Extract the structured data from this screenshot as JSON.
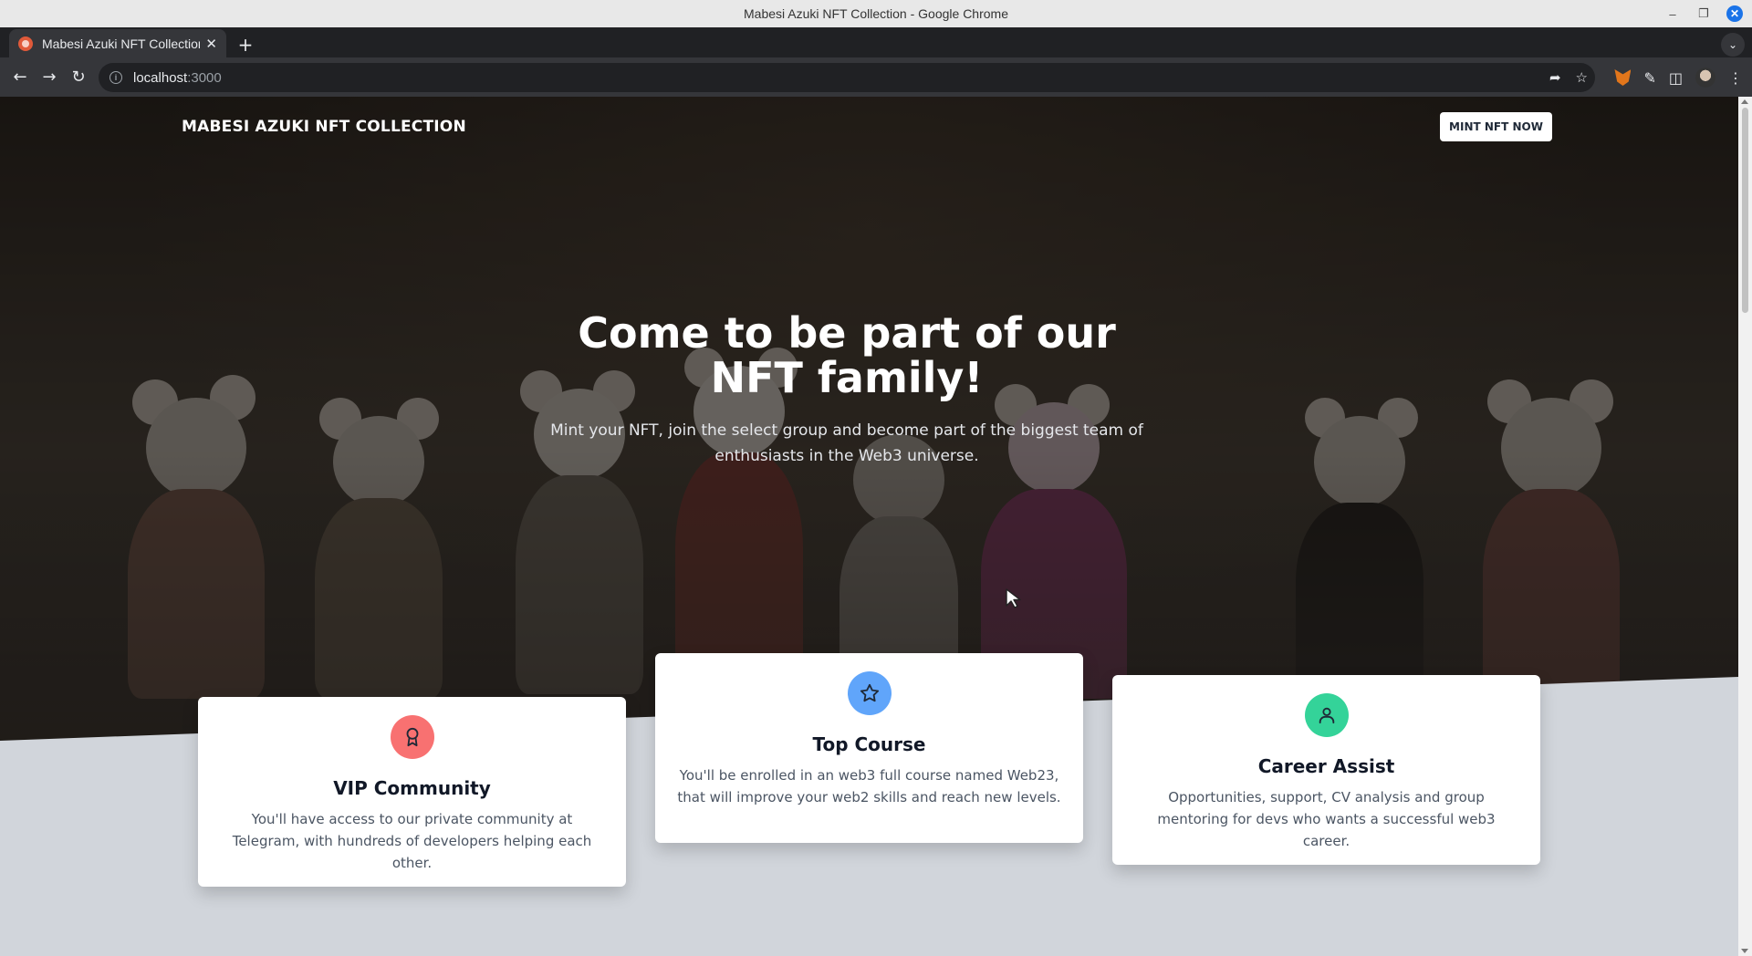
{
  "window": {
    "title": "Mabesi Azuki NFT Collection - Google Chrome"
  },
  "tab": {
    "title": "Mabesi Azuki NFT Collection"
  },
  "address_bar": {
    "host": "localhost",
    "port": ":3000"
  },
  "colors": {
    "vip_icon_bg": "#f87171",
    "course_icon_bg": "#60a5fa",
    "career_icon_bg": "#34d399",
    "page_bg": "#d1d5db"
  },
  "header": {
    "brand": "MABESI AZUKI NFT COLLECTION",
    "cta": "MINT NFT NOW"
  },
  "hero": {
    "headline": "Come to be part of our NFT family!",
    "subline": "Mint your NFT, join the select group and become part of the biggest team of enthusiasts in the Web3 universe."
  },
  "features": [
    {
      "icon": "award-ribbon-icon",
      "title": "VIP Community",
      "text": "You'll have access to our private community at Telegram, with hundreds of developers helping each other."
    },
    {
      "icon": "star-icon",
      "title": "Top Course",
      "text": "You'll be enrolled in an web3 full course named Web23, that will improve your web2 skills and reach new levels."
    },
    {
      "icon": "user-icon",
      "title": "Career Assist",
      "text": "Opportunities, support, CV analysis and group mentoring for devs who wants a successful web3 career."
    }
  ]
}
